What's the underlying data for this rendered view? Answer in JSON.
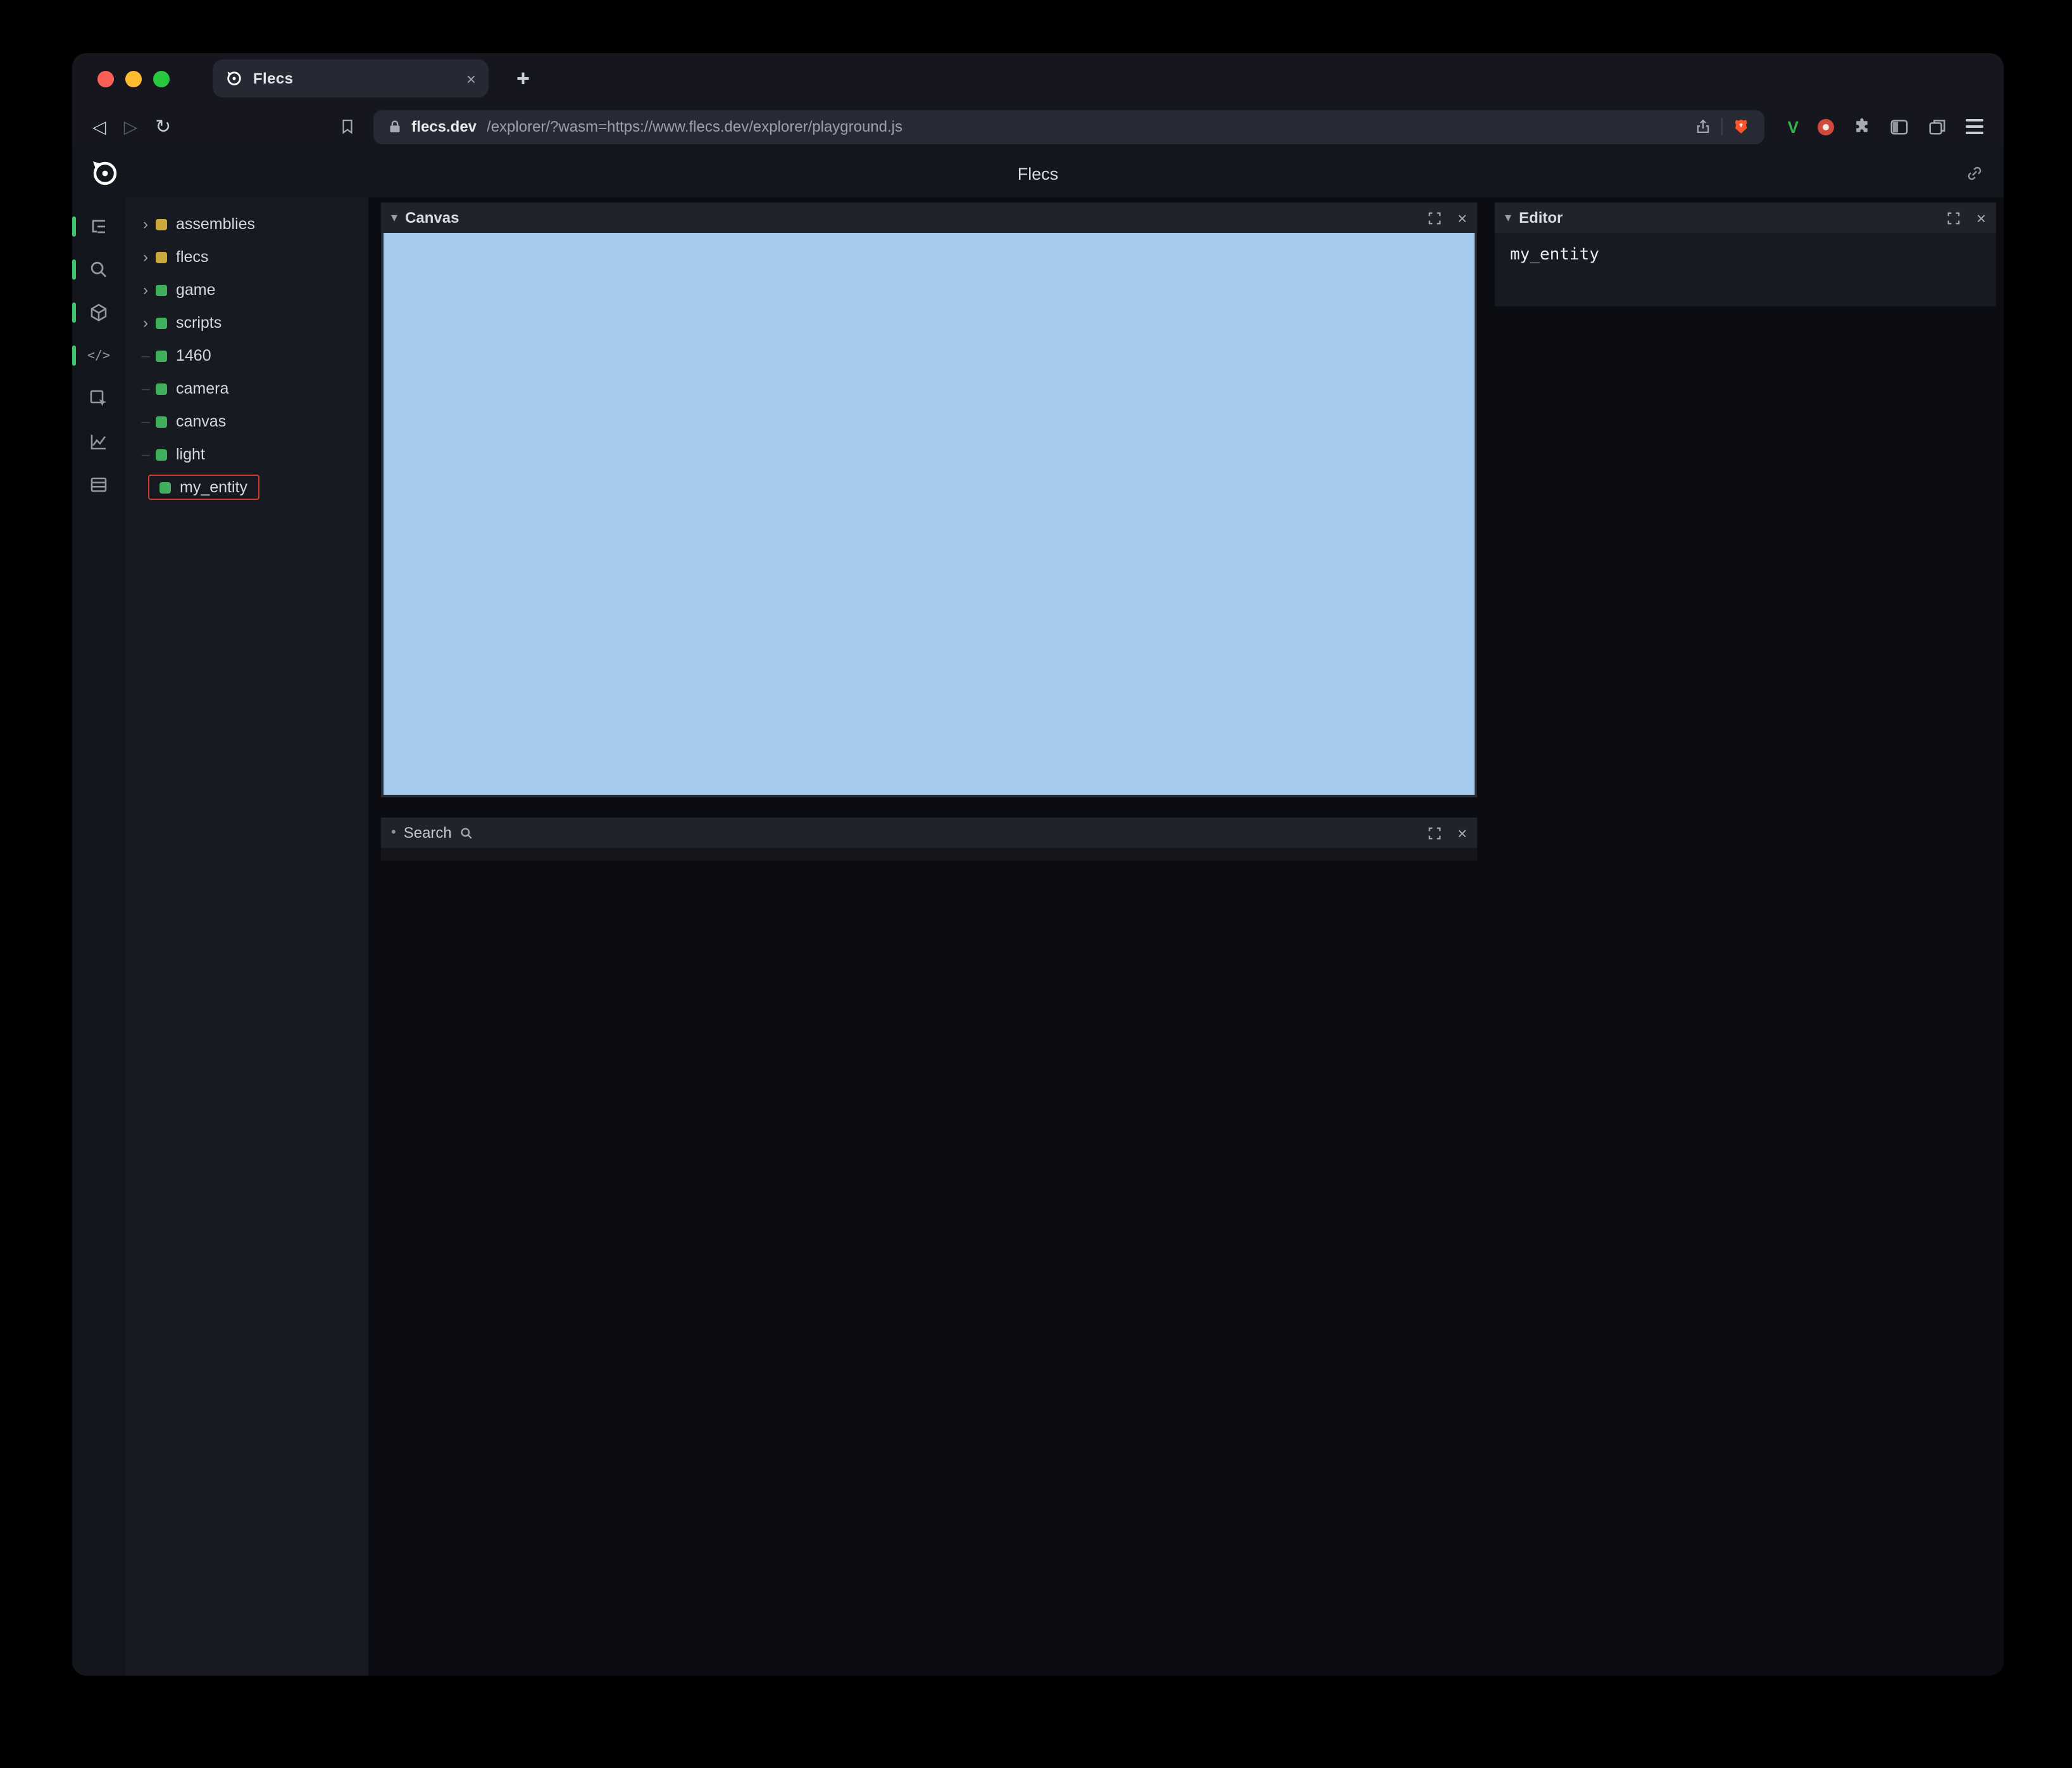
{
  "browser": {
    "tab": {
      "title": "Flecs"
    },
    "url": {
      "domain": "flecs.dev",
      "path": "/explorer/?wasm=https://www.flecs.dev/explorer/playground.js"
    }
  },
  "app": {
    "title": "Flecs",
    "tree": {
      "items": [
        {
          "label": "assemblies",
          "color": "#c9a93d",
          "expandable": true
        },
        {
          "label": "flecs",
          "color": "#c9a93d",
          "expandable": true
        },
        {
          "label": "game",
          "color": "#3faf5d",
          "expandable": true
        },
        {
          "label": "scripts",
          "color": "#3faf5d",
          "expandable": true
        },
        {
          "label": "1460",
          "color": "#3faf5d",
          "expandable": false
        },
        {
          "label": "camera",
          "color": "#3faf5d",
          "expandable": false
        },
        {
          "label": "canvas",
          "color": "#3faf5d",
          "expandable": false
        },
        {
          "label": "light",
          "color": "#3faf5d",
          "expandable": false
        },
        {
          "label": "my_entity",
          "color": "#3faf5d",
          "expandable": false,
          "highlighted": true
        }
      ]
    },
    "panels": {
      "canvas": {
        "title": "Canvas",
        "fill": "#a4cbee"
      },
      "search": {
        "title": "Search"
      },
      "editor": {
        "title": "Editor",
        "content": "my_entity"
      }
    }
  },
  "icons": {
    "chevron_right": "›",
    "leaf_dash": "–",
    "panel_chevron": "▾",
    "close": "×",
    "back": "◁",
    "forward": "▷",
    "reload": "↻",
    "new_tab": "+",
    "bullet": "•",
    "code": "</>",
    "v_extension": "V"
  },
  "colors": {
    "entity_green": "#3faf5d",
    "module_yellow": "#c9a93d",
    "highlight_red": "#cf3b2b",
    "rail_indicator_green": "#3ec46d",
    "canvas_blue": "#a4cbee",
    "brave_orange": "#fb542b",
    "v_green": "#35b54a",
    "extension_red": "#d04a3c"
  }
}
